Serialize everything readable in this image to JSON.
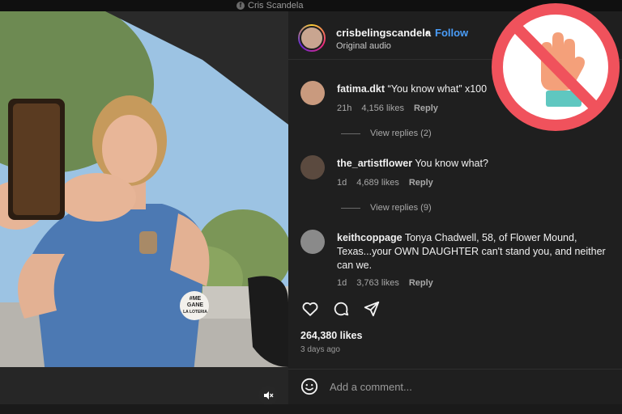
{
  "watermark": {
    "text": "Cris Scandela",
    "icon": "facebook-icon"
  },
  "post": {
    "username": "crisbelingscandela",
    "separator": "•",
    "follow_label": "Follow",
    "subtitle": "Original audio"
  },
  "comments": [
    {
      "user": "fatima.dkt",
      "text": "“You know what” x100",
      "time": "21h",
      "likes": "4,156 likes",
      "reply": "Reply",
      "view_replies": "View replies (2)"
    },
    {
      "user": "the_artistflower",
      "text": "You know what?",
      "time": "1d",
      "likes": "4,689 likes",
      "reply": "Reply",
      "view_replies": "View replies (9)"
    },
    {
      "user": "keithcoppage",
      "text": "Tonya Chadwell, 58, of Flower Mound, Texas...your OWN DAUGHTER can't stand you, and neither can we.",
      "time": "1d",
      "likes": "3,763 likes",
      "reply": "Reply"
    }
  ],
  "actions": {
    "like_icon": "heart-icon",
    "comment_icon": "comment-icon",
    "share_icon": "send-icon"
  },
  "stats": {
    "likes": "264,380 likes",
    "date": "3 days ago"
  },
  "add_comment": {
    "placeholder": "Add a comment..."
  },
  "video": {
    "badge_line1": "#ME",
    "badge_line2": "GANE",
    "badge_line3": "LA LOTERIA"
  },
  "overlay": {
    "icon": "prohibited-hand-icon",
    "ring_color": "#f0525c",
    "hand_color": "#f4a07a",
    "cuff_color": "#5fc7c0"
  },
  "colors": {
    "panel_bg": "#1f1f1f",
    "link_blue": "#4a9df8"
  }
}
